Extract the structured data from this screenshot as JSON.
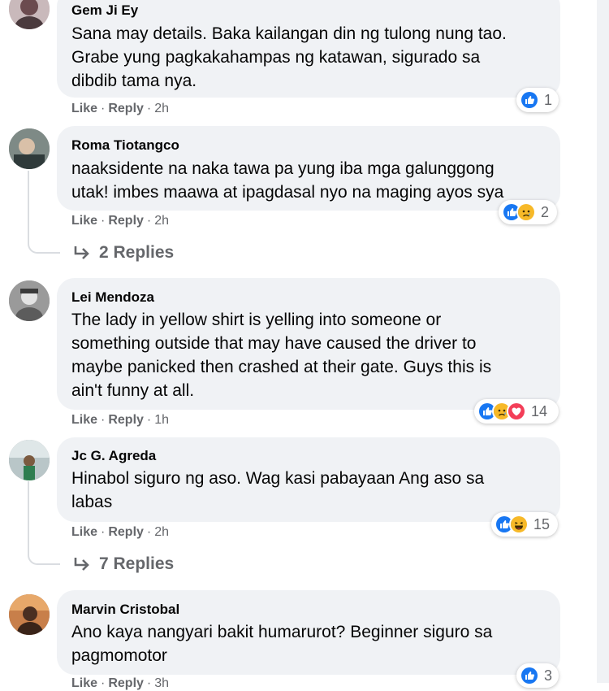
{
  "comments": [
    {
      "author": "Gem Ji Ey",
      "lines": [
        "Sana may details. Baka kailangan din ng tulong nung tao.",
        "Grabe yung pagkakahampas ng katawan, sigurado sa",
        "dibdib tama nya."
      ],
      "actions": {
        "like": "Like",
        "reply": "Reply",
        "time": "2h"
      },
      "reactions": {
        "icons": [
          "like"
        ],
        "count": "1"
      }
    },
    {
      "author": "Roma Tiotangco",
      "lines": [
        "naaksidente na naka tawa pa yung iba mga galunggong",
        "utak! imbes maawa at ipagdasal nyo na maging ayos sya"
      ],
      "actions": {
        "like": "Like",
        "reply": "Reply",
        "time": "2h"
      },
      "reactions": {
        "icons": [
          "like",
          "sad"
        ],
        "count": "2"
      },
      "replies": "2 Replies"
    },
    {
      "author": "Lei Mendoza",
      "lines": [
        "The lady in yellow shirt is yelling into someone or",
        "something outside that may have caused the driver to",
        "maybe panicked then crashed at their gate. Guys this is",
        "ain't funny at all."
      ],
      "actions": {
        "like": "Like",
        "reply": "Reply",
        "time": "1h"
      },
      "reactions": {
        "icons": [
          "like",
          "sad",
          "love"
        ],
        "count": "14"
      }
    },
    {
      "author": "Jc G. Agreda",
      "lines": [
        "Hinabol siguro ng aso. Wag kasi pabayaan Ang aso sa",
        "labas"
      ],
      "actions": {
        "like": "Like",
        "reply": "Reply",
        "time": "2h"
      },
      "reactions": {
        "icons": [
          "like",
          "haha"
        ],
        "count": "15"
      },
      "replies": "7 Replies"
    },
    {
      "author": "Marvin Cristobal",
      "lines": [
        "Ano kaya nangyari bakit humarurot? Beginner siguro sa",
        "pagmomotor"
      ],
      "actions": {
        "like": "Like",
        "reply": "Reply",
        "time": "3h"
      },
      "reactions": {
        "icons": [
          "like"
        ],
        "count": "3"
      }
    }
  ],
  "colors": {
    "bubble": "#f0f2f5",
    "meta_text": "#65676b",
    "like_blue": "#1877f2",
    "love_red": "#f33e58",
    "emoji_yellow": "#f7b928"
  }
}
